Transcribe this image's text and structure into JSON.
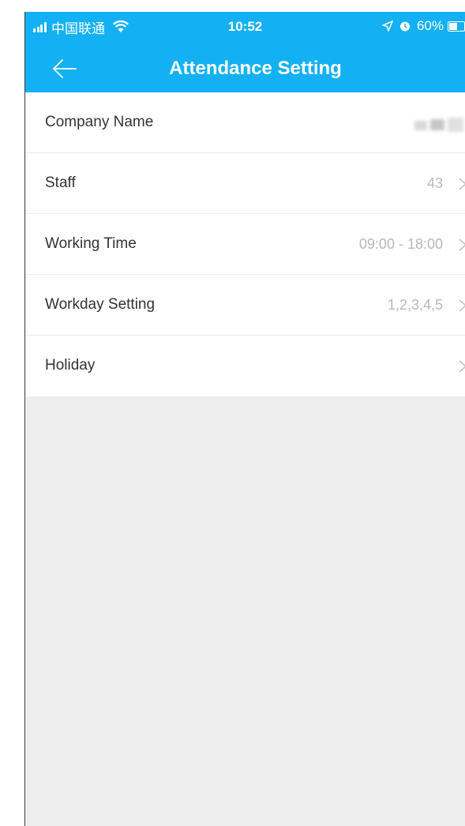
{
  "status_bar": {
    "carrier": "中国联通",
    "time": "10:52",
    "battery": "60%",
    "battery_level": 0.6
  },
  "navbar": {
    "title": "Attendance Setting"
  },
  "settings": [
    {
      "label": "Company Name",
      "value": ""
    },
    {
      "label": "Staff",
      "value": "43"
    },
    {
      "label": "Working Time",
      "value": "09:00 - 18:00"
    },
    {
      "label": "Workday Setting",
      "value": "1,2,3,4,5"
    },
    {
      "label": "Holiday",
      "value": ""
    }
  ],
  "icons": [
    "signal-icon",
    "wifi-icon",
    "location-icon",
    "alarm-icon",
    "battery-icon",
    "back-arrow-icon",
    "chevron-right-icon"
  ],
  "colors": {
    "accent": "#13b1f3",
    "background": "#ededed"
  }
}
